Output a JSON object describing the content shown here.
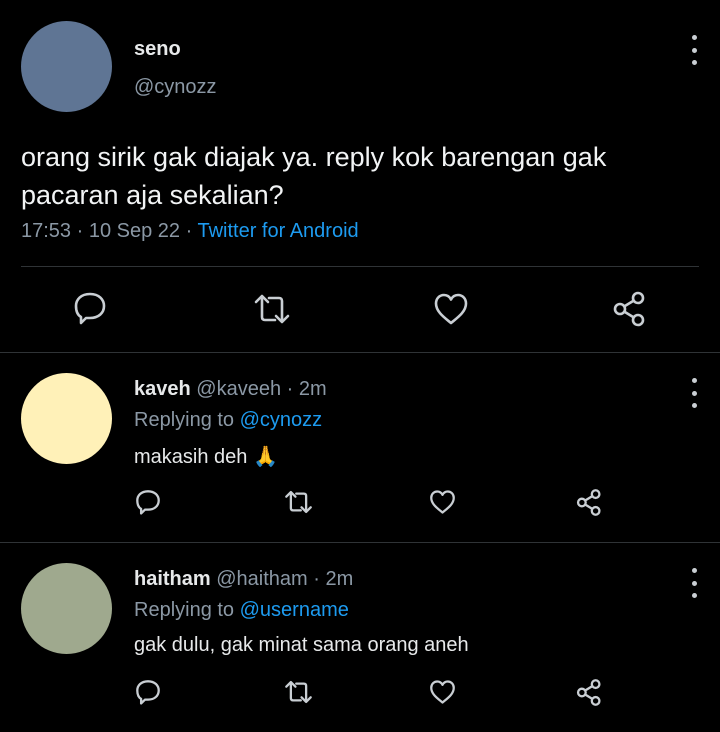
{
  "main_tweet": {
    "name": "seno",
    "handle": "@cynozz",
    "text": "orang sirik gak diajak ya. reply kok barengan gak pacaran aja sekalian?",
    "time": "17:53",
    "separator1": " · ",
    "date": "10 Sep 22",
    "separator2": " · ",
    "source": "Twitter for Android",
    "avatar_color": "#5f7594"
  },
  "replies": [
    {
      "name": "kaveh",
      "handle": "@kaveeh",
      "time": "· 2m",
      "replying_label": "Replying to",
      "replying_to": "@cynozz",
      "text": "makasih deh",
      "emoji": "🙏",
      "avatar_color": "#fff1b8"
    },
    {
      "name": "haitham",
      "handle": "@haitham",
      "time": "· 2m",
      "replying_label": "Replying to",
      "replying_to": "@username",
      "text": "gak dulu, gak minat sama orang aneh",
      "avatar_color": "#9fa98e"
    }
  ],
  "icons": [
    "comment-icon",
    "retweet-icon",
    "like-icon",
    "share-icon",
    "more-options-icon"
  ],
  "colors": {
    "background": "#000000",
    "link": "#1d9bf0",
    "secondary_text": "#8b98a5",
    "divider": "#2f3336"
  }
}
